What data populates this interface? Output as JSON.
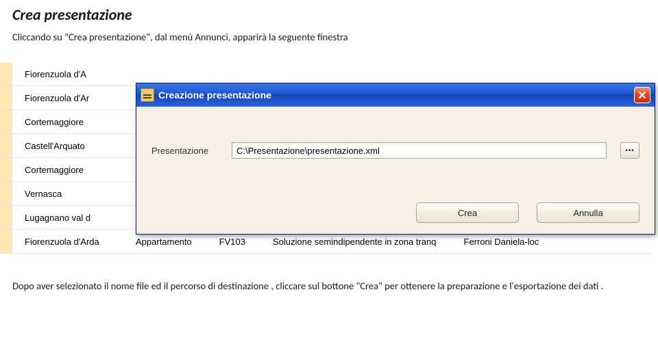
{
  "doc": {
    "title": "Crea presentazione",
    "subtitle": "Cliccando su \"Crea presentazione\",  dal menù Annunci,  apparirà la seguente finestra",
    "footer": "Dopo aver selezionato il nome file ed il percorso di destinazione ,  cliccare sul bottone \"Crea\" per ottenere la  preparazione e l'esportazione dei dati ."
  },
  "grid": {
    "rows": [
      "Fiorenzuola d'A",
      "Fiorenzuola d'Ar",
      "Cortemaggiore",
      "Castell'Arquato",
      "Cortemaggiore",
      "Vernasca",
      "Lugagnano val d",
      "Fiorenzuola d'Arda"
    ],
    "last_row": {
      "col2": "Appartamento",
      "col3": "FV103",
      "col4": "Soluzione semindipendente in zona tranq",
      "col5": "Ferroni Daniela-loc"
    }
  },
  "dialog": {
    "title": "Creazione presentazione",
    "field_label": "Presentazione",
    "field_value": "C:\\Presentazione\\presentazione.xml",
    "browse_dots": "•••",
    "btn_create": "Crea",
    "btn_cancel": "Annulla"
  }
}
